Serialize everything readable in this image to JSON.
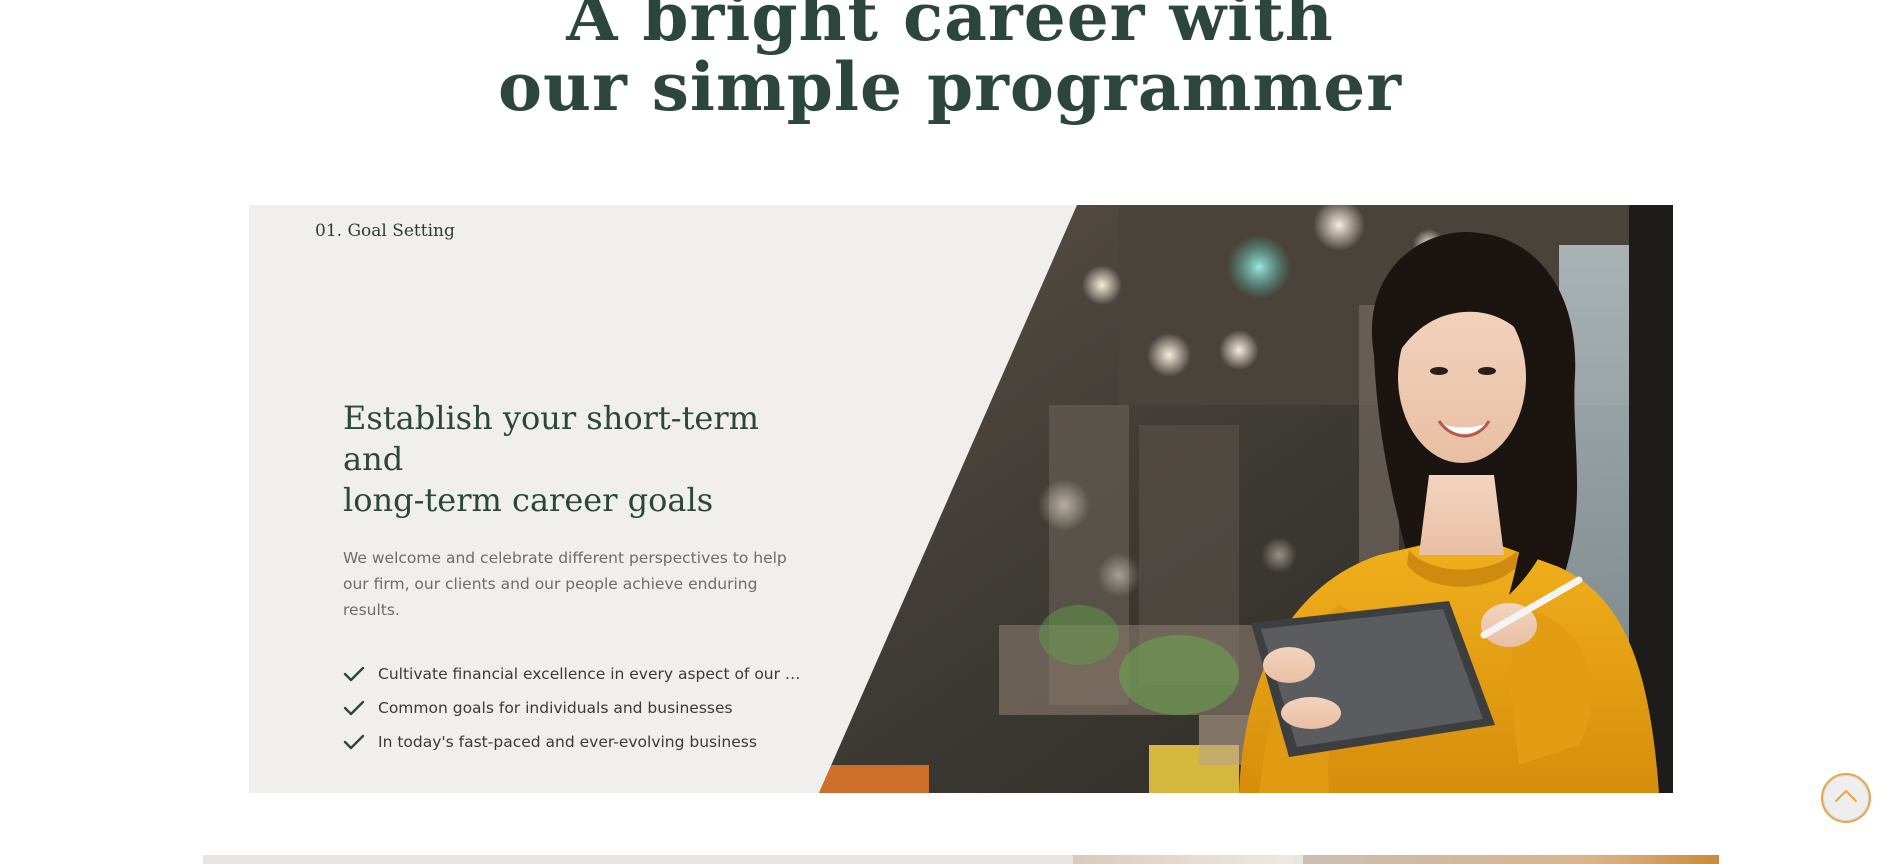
{
  "section": {
    "title_line1": "A bright career with",
    "title_line2": "our simple programmer"
  },
  "step": {
    "label": "01. Goal Setting",
    "heading_line1": "Establish your short-term and",
    "heading_line2": "long-term career goals",
    "description": "We welcome and celebrate different perspectives to help our firm, our clients and our people achieve enduring results.",
    "features": [
      {
        "text": "Cultivate financial excellence in every aspect of our clients'...",
        "icon": "check-icon"
      },
      {
        "text": "Common goals for individuals and businesses",
        "icon": "check-icon"
      },
      {
        "text": "In today's fast-paced and ever-evolving business",
        "icon": "check-icon"
      }
    ],
    "image": "woman-in-yellow-sweater-holding-tablet-photo"
  },
  "scroll_top": {
    "icon": "chevron-up-icon"
  },
  "colors": {
    "heading": "#2c463d",
    "card_background": "#f1efed",
    "accent": "#e6a74a",
    "body_text": "#6c6c6c"
  }
}
